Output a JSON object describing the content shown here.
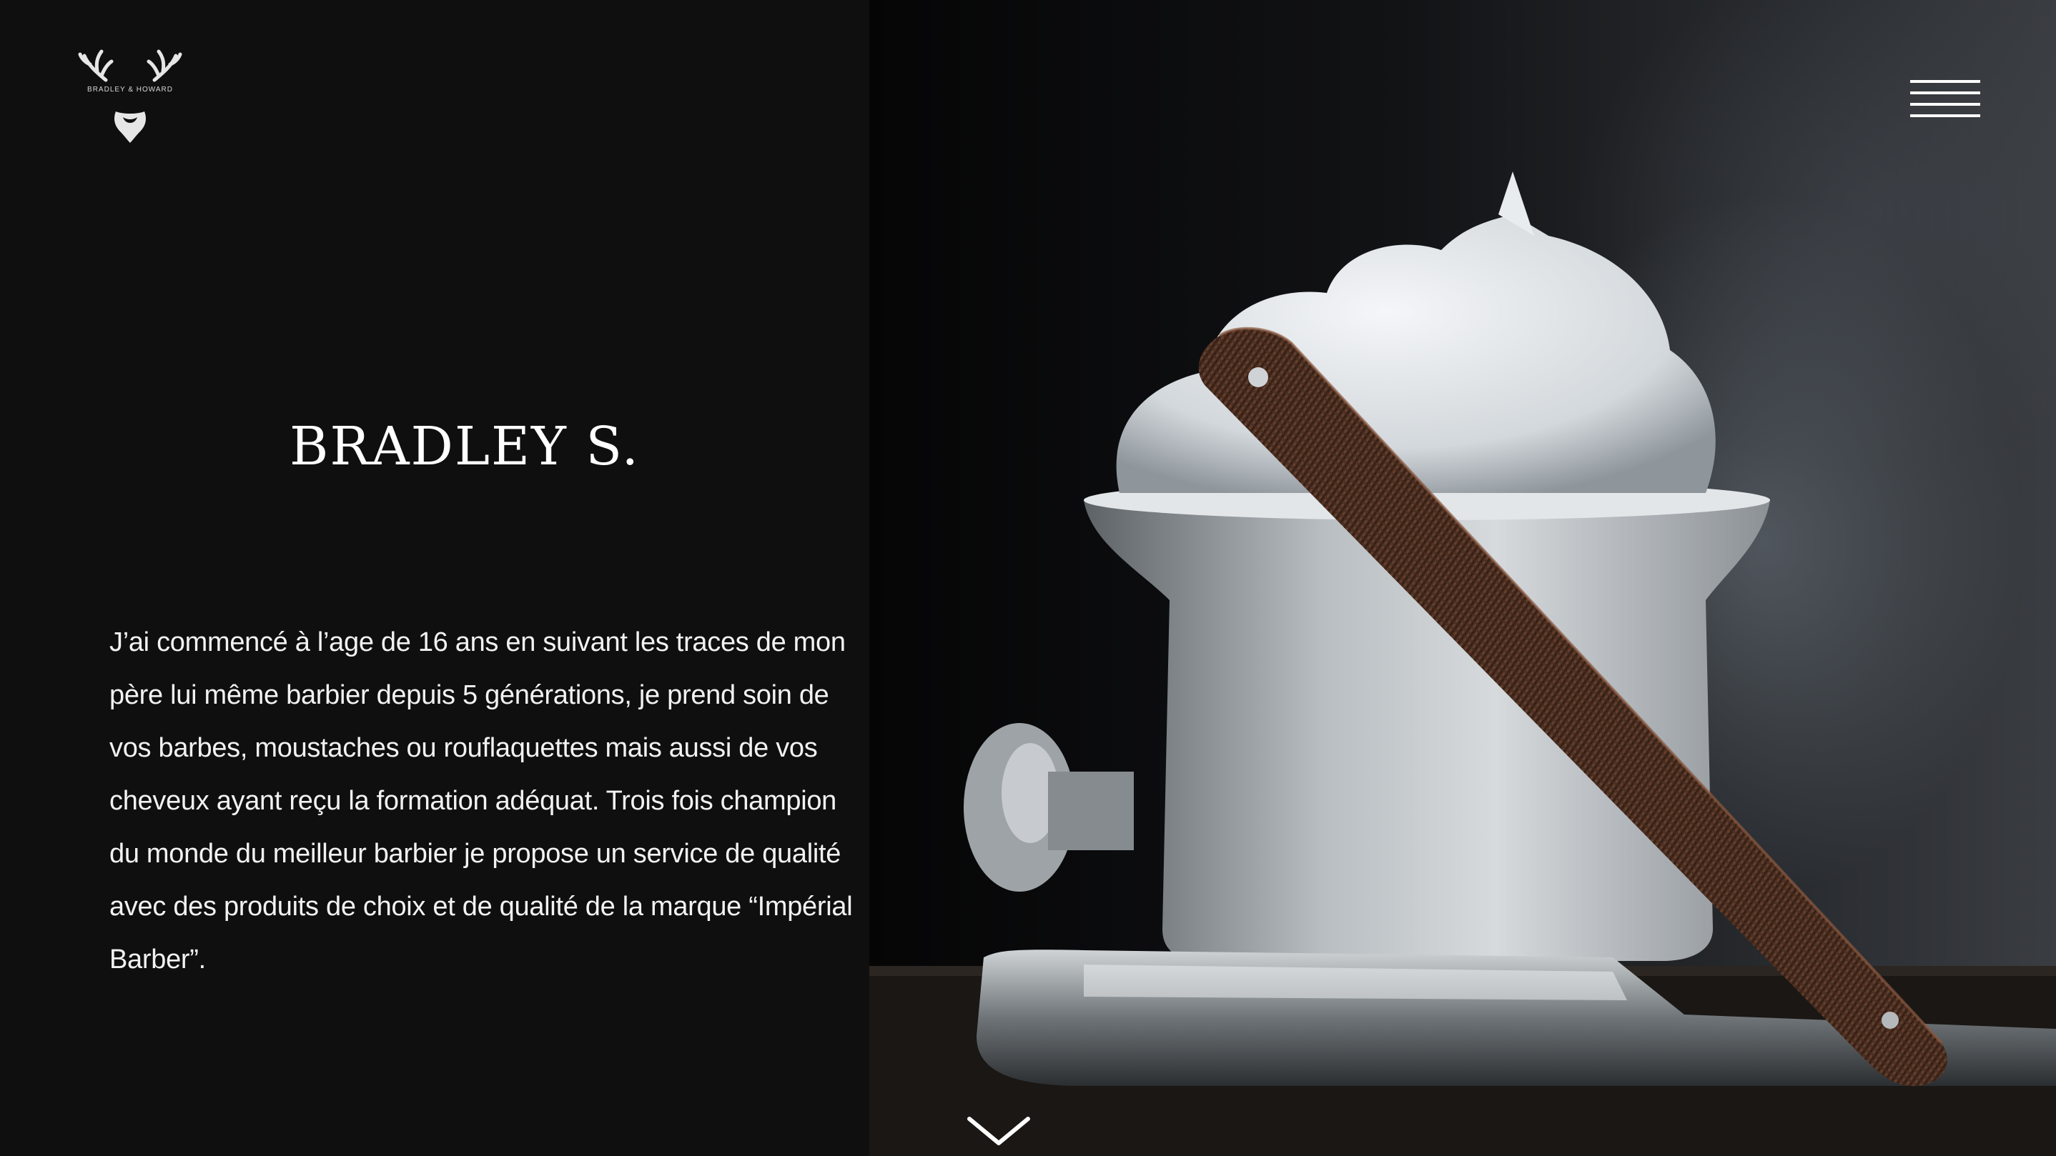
{
  "brand": {
    "name": "BRADLEY & HOWARD",
    "logo_icon": "antlers-beard-logo"
  },
  "header": {
    "menu_icon": "hamburger-menu-icon"
  },
  "profile": {
    "name": "BRADLEY S.",
    "bio": "J’ai commencé à l’age de 16 ans en suivant les traces de mon père lui même barbier depuis 5 générations, je prend soin de vos barbes, moustaches ou rouflaquettes mais aussi de vos cheveux ayant reçu la formation adéquat. Trois fois champion du monde du meilleur barbier je propose un service de qualité avec des produits de choix et de qualité de la marque “Impérial Barber”."
  },
  "hero": {
    "image_subject": "shaving-bowl-foam-straight-razor"
  },
  "navigation": {
    "scroll_icon": "chevron-down-icon"
  },
  "colors": {
    "panel_background": "#0f0f10",
    "text": "#ffffff",
    "razor_handle": "#5a3a2a",
    "foam": "#e8ecef"
  }
}
